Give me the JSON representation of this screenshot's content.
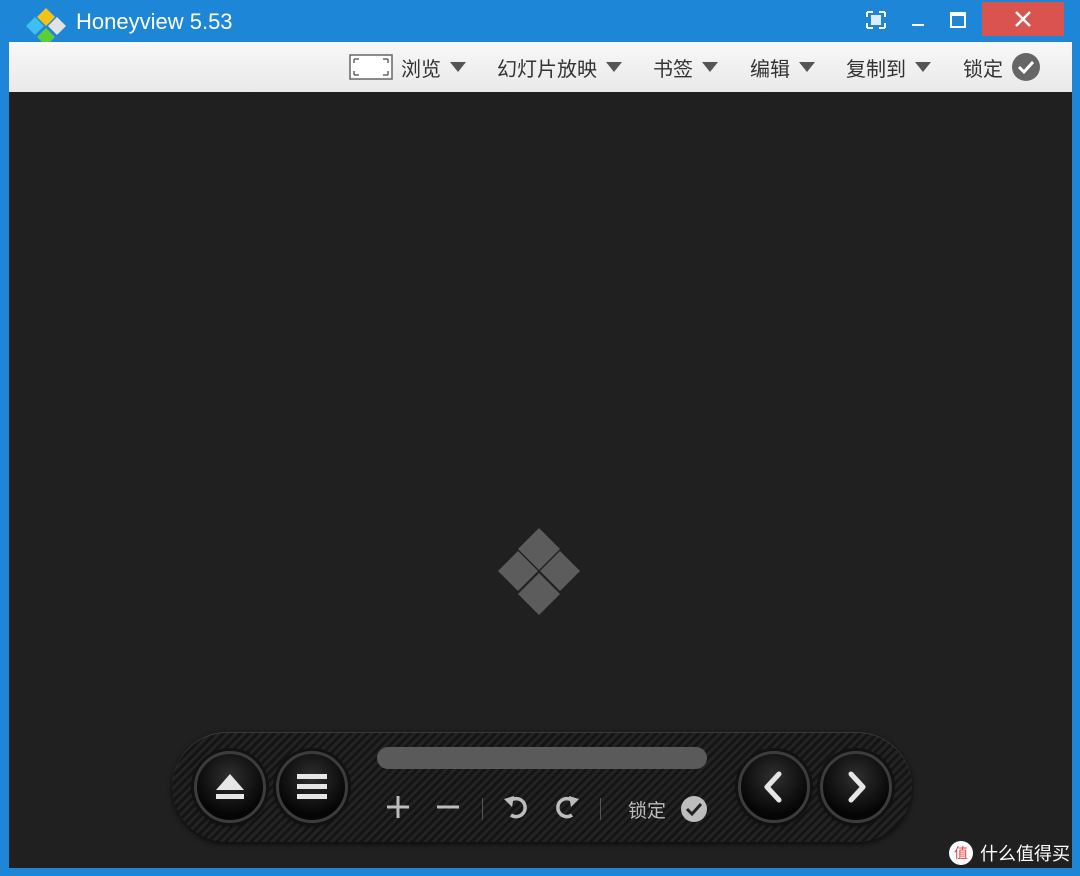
{
  "window": {
    "title": "Honeyview 5.53",
    "accent_color": "#1e86d6",
    "close_color": "#d9534f"
  },
  "titlebar": {
    "buttons": [
      "fullscreen-icon",
      "minimize-icon",
      "maximize-icon",
      "close-icon"
    ]
  },
  "menu": {
    "browse": "浏览",
    "slideshow": "幻灯片放映",
    "bookmarks": "书签",
    "edit": "编辑",
    "copy_to": "复制到",
    "lock": "锁定"
  },
  "controls": {
    "progress": 0,
    "lock": "锁定"
  },
  "watermark": {
    "text": "什么值得买"
  }
}
